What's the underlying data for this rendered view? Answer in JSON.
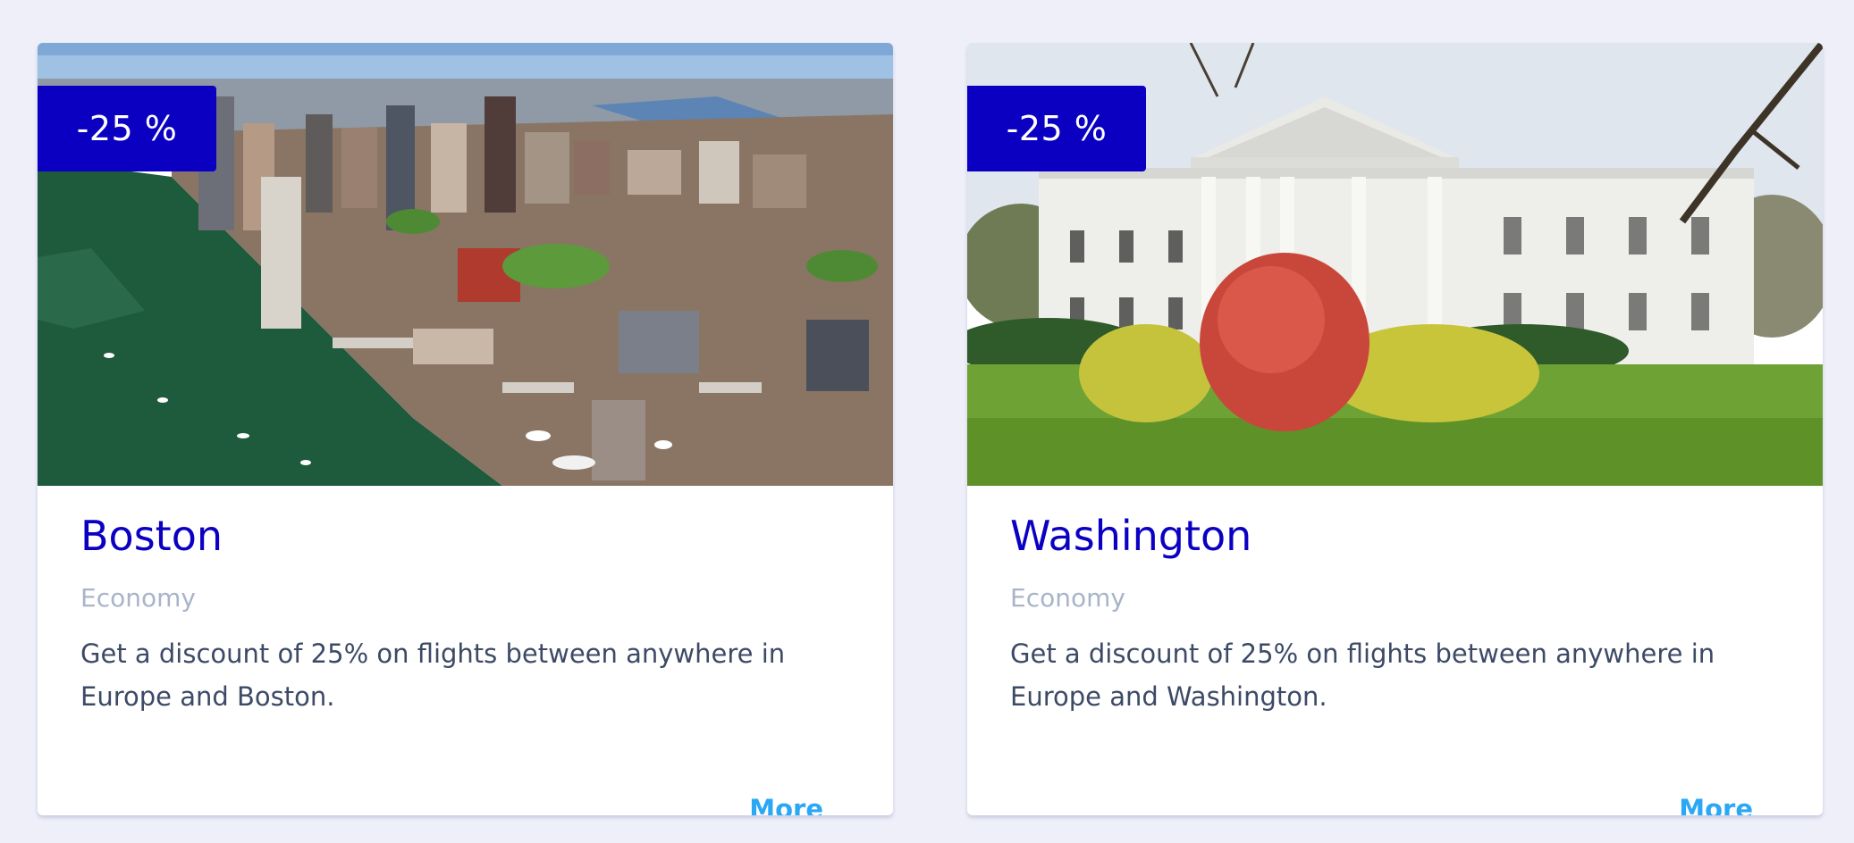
{
  "cards": [
    {
      "badge": "-25 %",
      "city": "Boston",
      "category": "Economy",
      "description": "Get a discount of 25% on flights between anywhere in Europe and Boston.",
      "more_label": "More"
    },
    {
      "badge": "-25 %",
      "city": "Washington",
      "category": "Economy",
      "description": "Get a discount of 25% on flights between anywhere in Europe and Washington.",
      "more_label": "More"
    }
  ],
  "colors": {
    "page_background": "#eeeff9",
    "badge_background": "#0b00c2",
    "city_title": "#0b00c2",
    "category_text": "#a9b4c9",
    "description_text": "#3d4a66",
    "link": "#2aa8f5"
  }
}
